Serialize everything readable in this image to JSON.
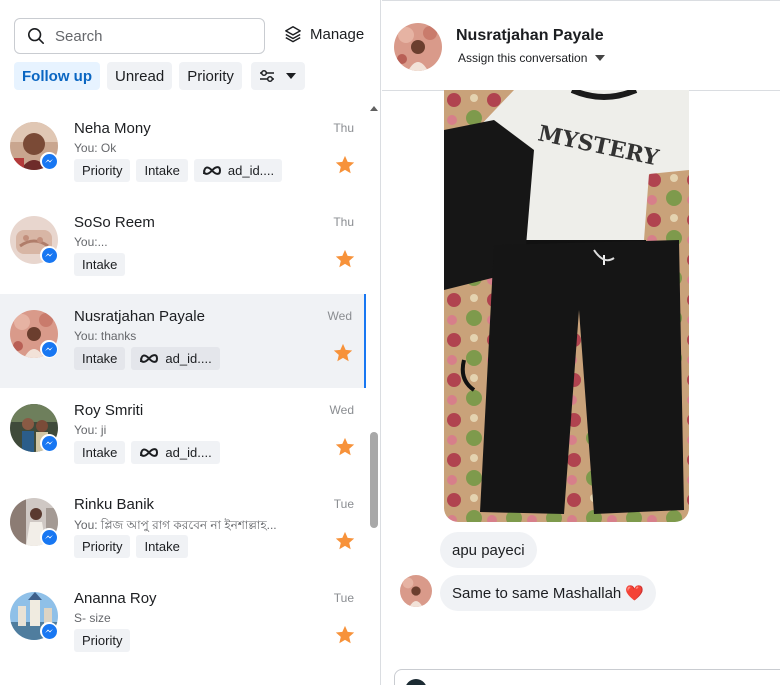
{
  "search": {
    "placeholder": "Search"
  },
  "manage": {
    "label": "Manage"
  },
  "filters": [
    {
      "label": "Follow up",
      "active": true
    },
    {
      "label": "Unread",
      "active": false
    },
    {
      "label": "Priority",
      "active": false
    }
  ],
  "colors": {
    "accent": "#1877f2",
    "star": "#f7923a",
    "active_chip_bg": "#e7f3ff"
  },
  "conversations": [
    {
      "name": "Neha Mony",
      "preview": "You: Ok",
      "day": "Thu",
      "tags": [
        "Priority",
        "Intake",
        "ad_id...."
      ],
      "starred": true
    },
    {
      "name": "SoSo Reem",
      "preview": "You:...",
      "day": "Thu",
      "tags": [
        "Intake"
      ],
      "starred": true
    },
    {
      "name": "Nusratjahan Payale",
      "preview": "You: thanks",
      "day": "Wed",
      "tags": [
        "Intake",
        "ad_id...."
      ],
      "starred": true,
      "selected": true
    },
    {
      "name": "Roy Smriti",
      "preview": "You: ji",
      "day": "Wed",
      "tags": [
        "Intake",
        "ad_id...."
      ],
      "starred": true
    },
    {
      "name": "Rinku Banik",
      "preview": "You: প্লিজ আপু রাগ করবেন না ইনশাল্লাহ...",
      "day": "Tue",
      "tags": [
        "Priority",
        "Intake"
      ],
      "starred": true
    },
    {
      "name": "Ananna Roy",
      "preview": "S- size",
      "day": "Tue",
      "tags": [
        "Priority"
      ],
      "starred": true
    }
  ],
  "chat": {
    "name": "Nusratjahan Payale",
    "assign_label": "Assign this conversation",
    "messages": [
      {
        "text": "apu payeci"
      },
      {
        "text": "Same to same Mashallah ❤️"
      }
    ]
  }
}
